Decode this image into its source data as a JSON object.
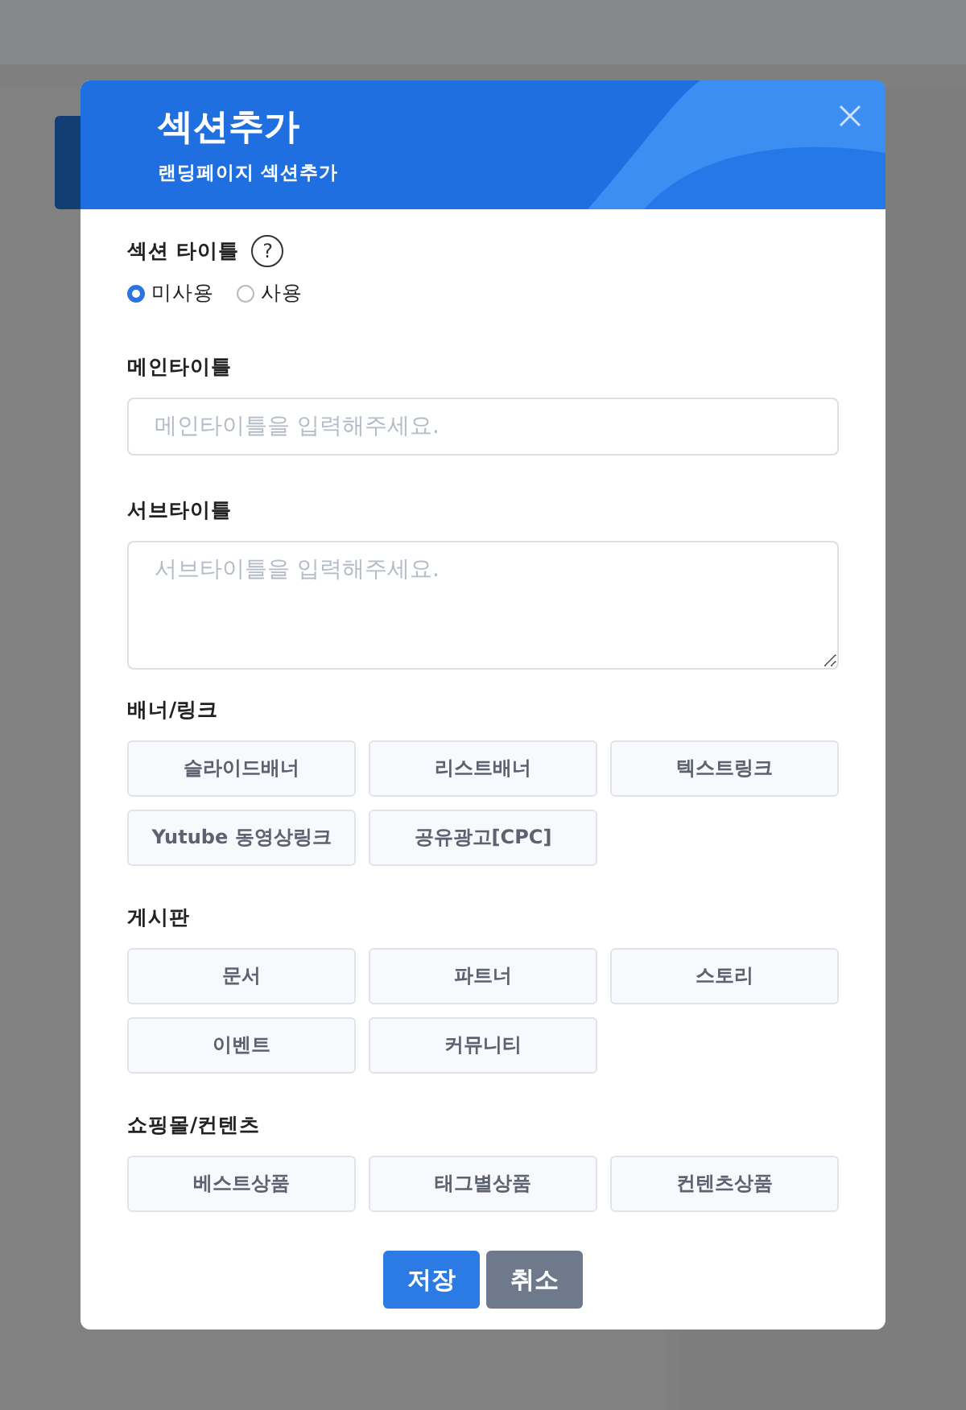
{
  "modal": {
    "title": "섹션추가",
    "subtitle": "랜딩페이지 섹션추가"
  },
  "section_title": {
    "label": "섹션 타이틀",
    "help": "?",
    "options": [
      {
        "label": "미사용",
        "selected": true
      },
      {
        "label": "사용",
        "selected": false
      }
    ]
  },
  "main_title": {
    "label": "메인타이틀",
    "placeholder": "메인타이틀을 입력해주세요."
  },
  "sub_title": {
    "label": "서브타이틀",
    "placeholder": "서브타이틀을 입력해주세요."
  },
  "groups": [
    {
      "label": "배너/링크",
      "items": [
        "슬라이드배너",
        "리스트배너",
        "텍스트링크",
        "Yutube 동영상링크",
        "공유광고[CPC]"
      ]
    },
    {
      "label": "게시판",
      "items": [
        "문서",
        "파트너",
        "스토리",
        "이벤트",
        "커뮤니티"
      ]
    },
    {
      "label": "쇼핑몰/컨텐츠",
      "items": [
        "베스트상품",
        "태그별상품",
        "컨텐츠상품"
      ]
    }
  ],
  "buttons": [
    {
      "label": "저장",
      "kind": "primary"
    },
    {
      "label": "취소",
      "kind": "secondary"
    }
  ]
}
